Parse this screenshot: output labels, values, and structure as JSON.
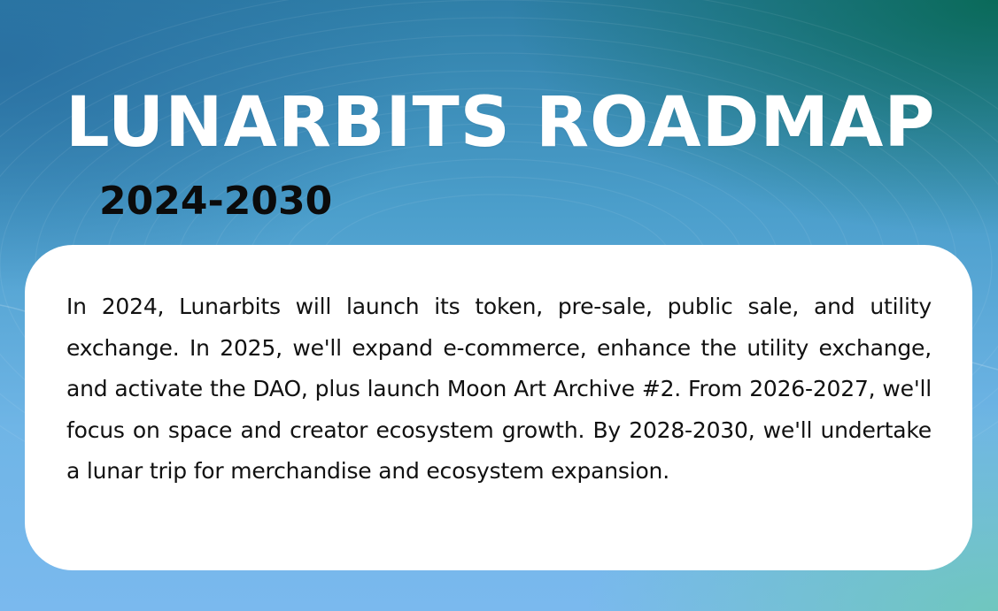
{
  "header": {
    "title": "LUNARBITS ROADMAP",
    "years": "2024-2030"
  },
  "card": {
    "body": "In 2024, Lunarbits will launch its token, pre-sale, public sale, and utility exchange. In 2025, we'll expand e-commerce, enhance the utility exchange, and activate the DAO, plus launch Moon Art Archive #2. From 2026-2027, we'll focus on space and creator ecosystem growth. By 2028-2030, we'll undertake a lunar trip for merchandise and ecosystem expansion."
  },
  "colors": {
    "title": "#ffffff",
    "years": "#0b0b0b",
    "card_background": "#ffffff",
    "bg_top_right": "#086955",
    "bg_bottom": "#7ab9ee"
  }
}
